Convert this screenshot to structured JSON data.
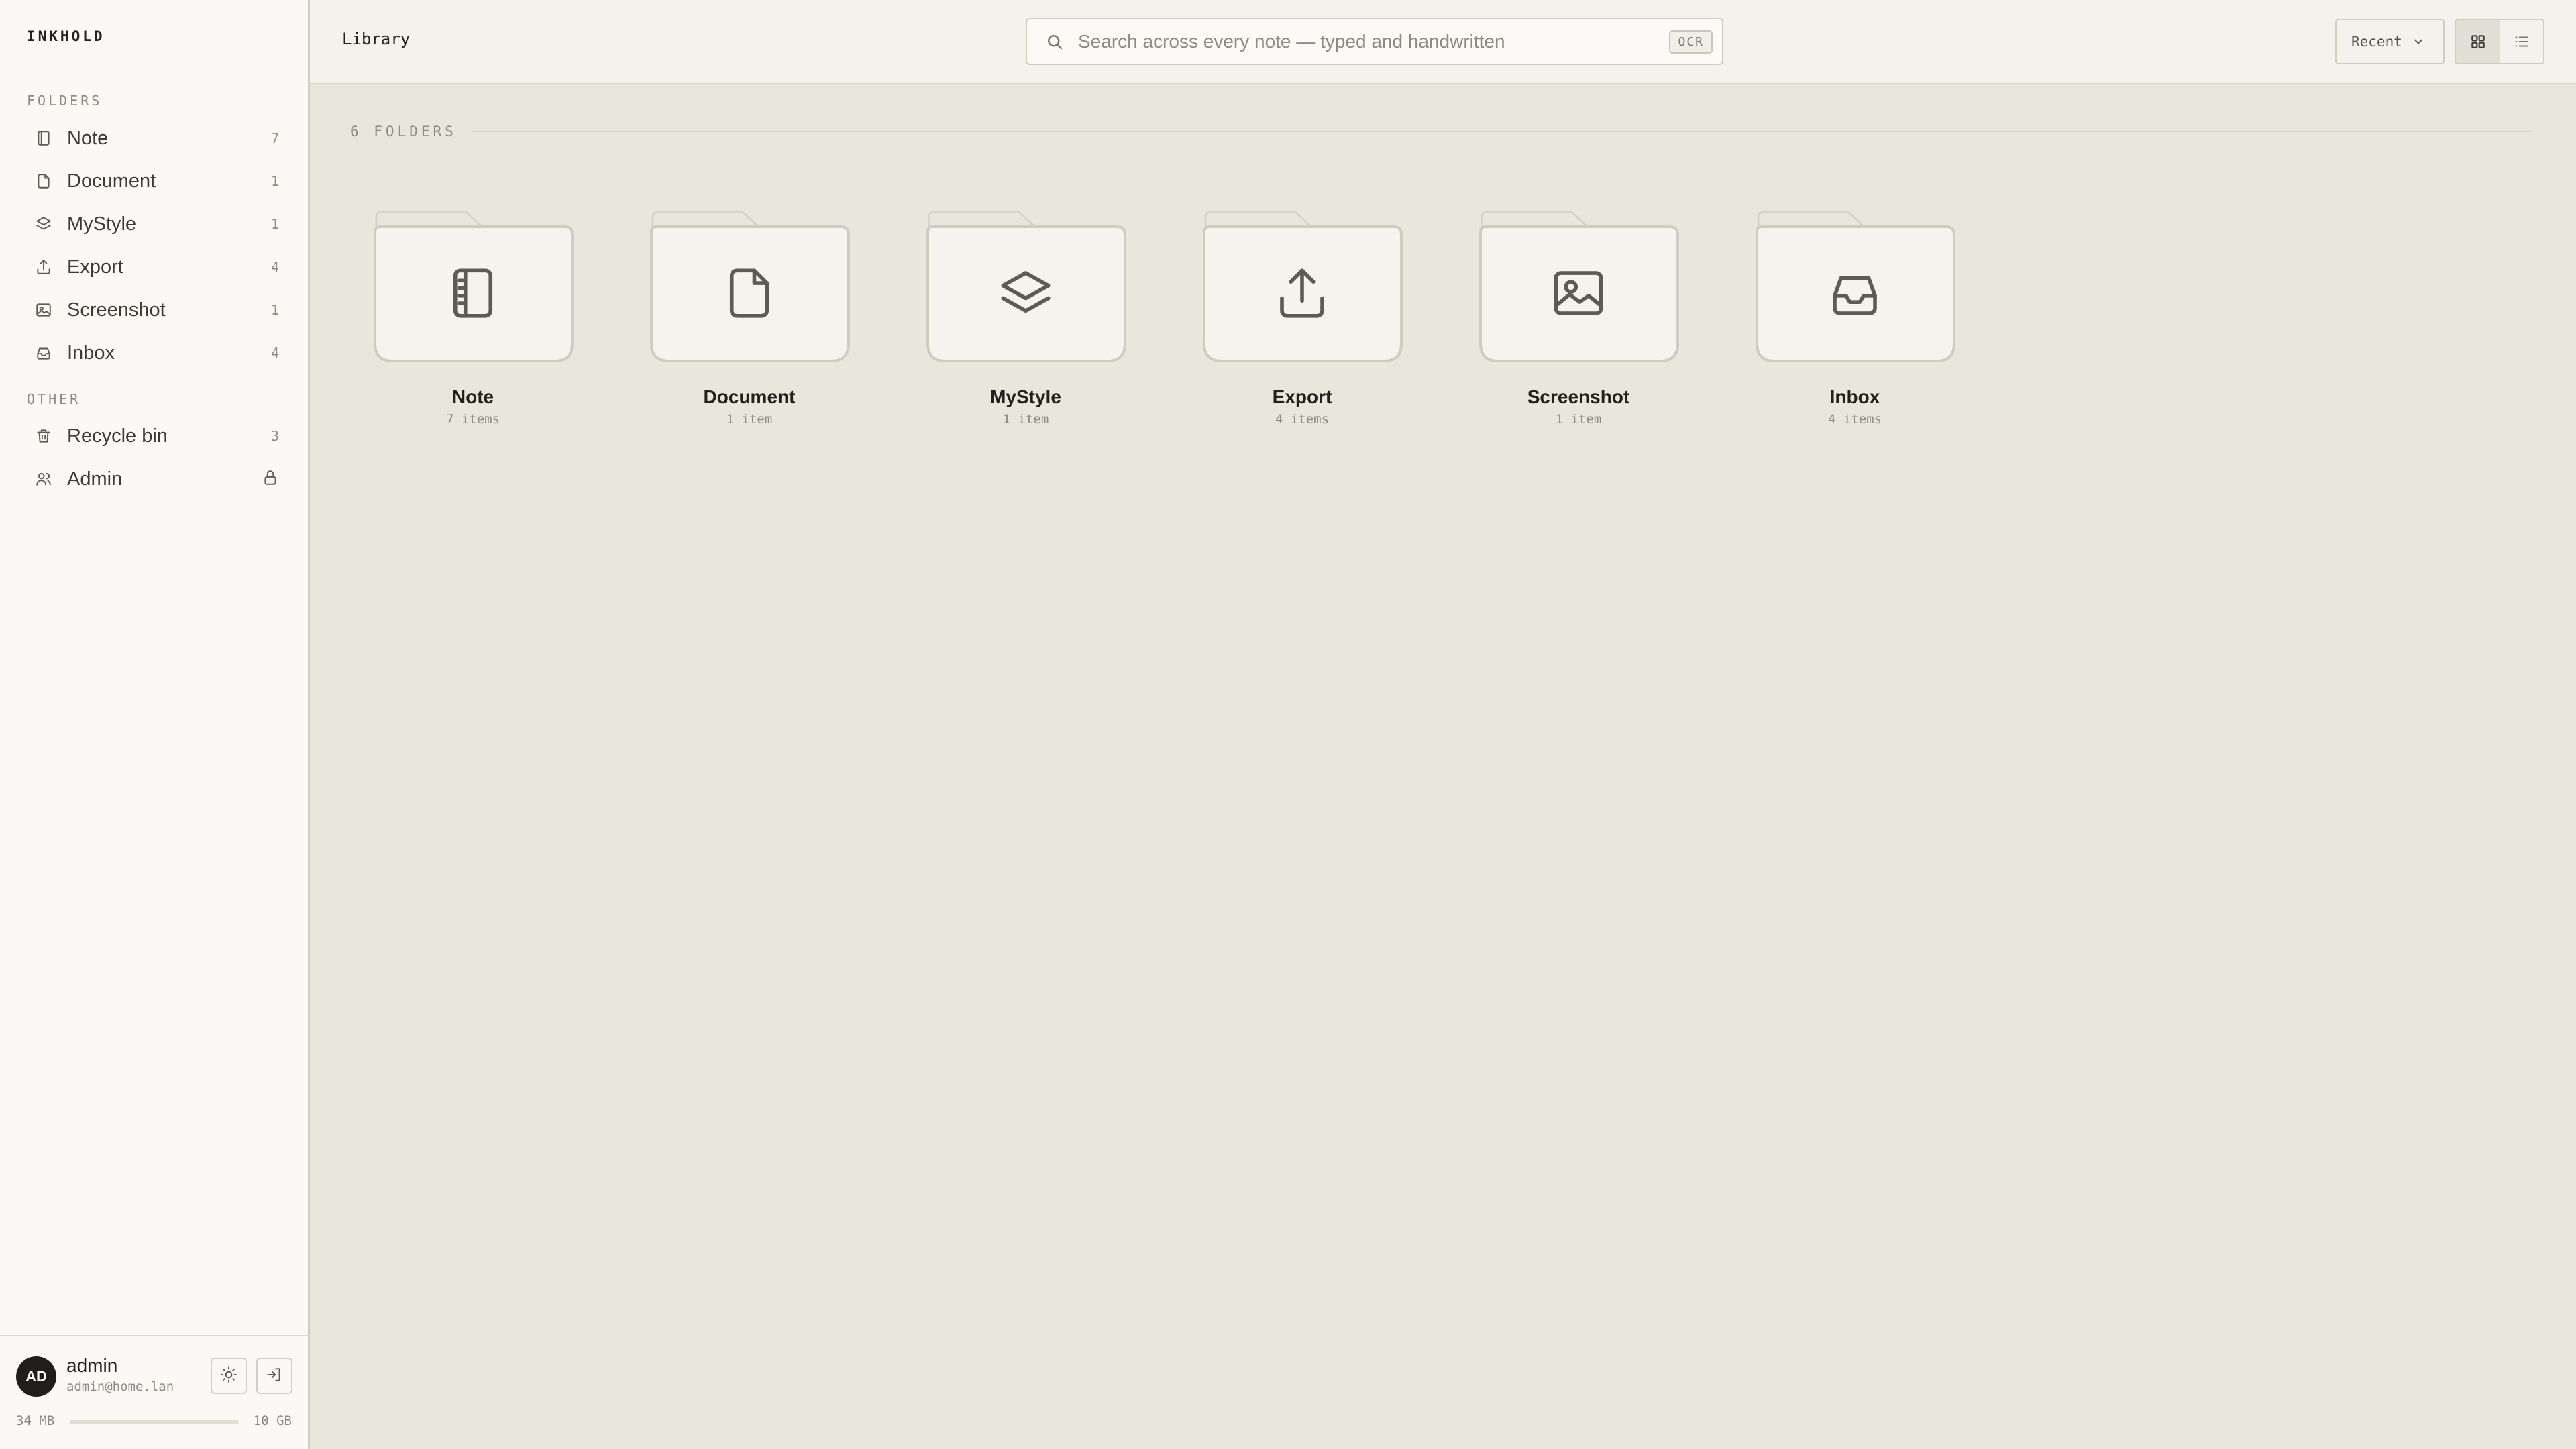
{
  "app": {
    "brand": "INKHOLD"
  },
  "sidebar": {
    "folders_heading": "FOLDERS",
    "other_heading": "OTHER",
    "folders": [
      {
        "label": "Note",
        "count": "7",
        "icon": "notebook-icon"
      },
      {
        "label": "Document",
        "count": "1",
        "icon": "document-icon"
      },
      {
        "label": "MyStyle",
        "count": "1",
        "icon": "layers-icon"
      },
      {
        "label": "Export",
        "count": "4",
        "icon": "upload-icon"
      },
      {
        "label": "Screenshot",
        "count": "1",
        "icon": "image-icon"
      },
      {
        "label": "Inbox",
        "count": "4",
        "icon": "inbox-icon"
      }
    ],
    "other": [
      {
        "label": "Recycle bin",
        "count": "3",
        "icon": "trash-icon"
      },
      {
        "label": "Admin",
        "icon": "users-icon",
        "trailing_icon": "lock-icon"
      }
    ],
    "user": {
      "initials": "AD",
      "name": "admin",
      "email": "admin@home.lan"
    },
    "storage": {
      "used": "34 MB",
      "total": "10 GB",
      "fill_fraction": 0.0034
    }
  },
  "topbar": {
    "breadcrumb": "Library",
    "search_placeholder": "Search across every note — typed and handwritten",
    "search_value": "",
    "search_badge": "OCR",
    "sort_label": "Recent",
    "view_mode": "grid"
  },
  "main": {
    "folders_count_label": "6 FOLDERS",
    "folders": [
      {
        "name": "Note",
        "meta": "7 items",
        "icon": "notebook-icon"
      },
      {
        "name": "Document",
        "meta": "1 item",
        "icon": "document-icon"
      },
      {
        "name": "MyStyle",
        "meta": "1 item",
        "icon": "layers-icon"
      },
      {
        "name": "Export",
        "meta": "4 items",
        "icon": "upload-icon"
      },
      {
        "name": "Screenshot",
        "meta": "1 item",
        "icon": "image-icon"
      },
      {
        "name": "Inbox",
        "meta": "4 items",
        "icon": "inbox-icon"
      }
    ]
  },
  "colors": {
    "background": "#e9e6dc",
    "sidebar": "#faf9f5",
    "topbar": "#f4f2ec",
    "folder_fill": "#f4f3ee",
    "folder_stroke": "#cfccc2",
    "icon_stroke": "#5d5b53",
    "avatar": "#1f1e1a"
  }
}
